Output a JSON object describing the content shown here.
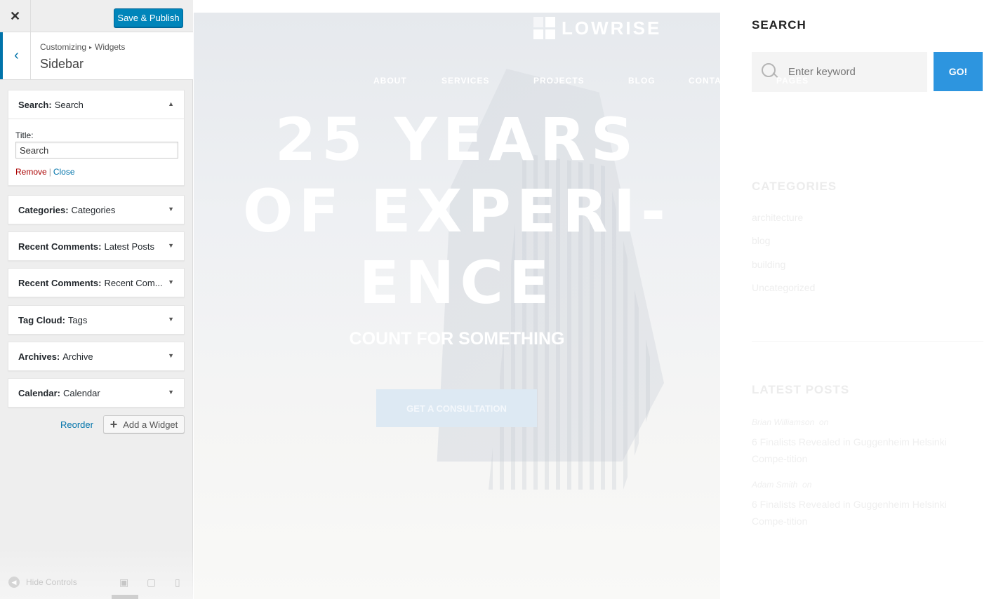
{
  "customizer": {
    "close_label": "✕",
    "save_label": "Save & Publish",
    "breadcrumb": {
      "part1": "Customizing",
      "separator": "▸",
      "part2": "Widgets"
    },
    "section_title": "Sidebar",
    "widgets": [
      {
        "type": "Search:",
        "name": "Search",
        "expanded": true
      },
      {
        "type": "Categories:",
        "name": "Categories",
        "expanded": false
      },
      {
        "type": "Recent Comments:",
        "name": "Latest Posts",
        "expanded": false
      },
      {
        "type": "Recent Comments:",
        "name": "Recent Com...",
        "expanded": false
      },
      {
        "type": "Tag Cloud:",
        "name": "Tags",
        "expanded": false
      },
      {
        "type": "Archives:",
        "name": "Archive",
        "expanded": false
      },
      {
        "type": "Calendar:",
        "name": "Calendar",
        "expanded": false
      }
    ],
    "search_widget": {
      "title_label": "Title:",
      "title_value": "Search",
      "remove_label": "Remove",
      "close_label": "Close"
    },
    "reorder_label": "Reorder",
    "add_widget_label": "Add a Widget",
    "hide_controls_label": "Hide Controls"
  },
  "preview": {
    "logo_text": "LOWRISE",
    "nav": [
      "ABOUT",
      "SERVICES",
      "PROJECTS",
      "BLOG",
      "CONTA"
    ],
    "nav_overlay": "PAGES",
    "hero_heading_lines": [
      "25 YEARS",
      "OF EXPERI-",
      "ENCE"
    ],
    "hero_sub": "COUNT FOR SOMETHING",
    "cta_label": "GET A CONSULTATION",
    "sidebar": {
      "search_title": "SEARCH",
      "search_placeholder": "Enter keyword",
      "go_label": "GO!",
      "categories_title": "CATEGORIES",
      "categories": [
        "architecture",
        "blog",
        "building",
        "Uncategorized"
      ],
      "latest_posts_title": "LATEST POSTS",
      "posts": [
        {
          "author": "Brian Williamson",
          "on": "on",
          "title": "6 Finalists Revealed in Guggenheim Helsinki Compe-tition"
        },
        {
          "author": "Adam Smith",
          "on": "on",
          "title": "6 Finalists Revealed in Guggenheim Helsinki Compe-tition"
        }
      ]
    }
  },
  "colors": {
    "accent": "#0085ba",
    "link": "#0073aa",
    "remove": "#aa0000",
    "go_button": "#2d95df"
  }
}
